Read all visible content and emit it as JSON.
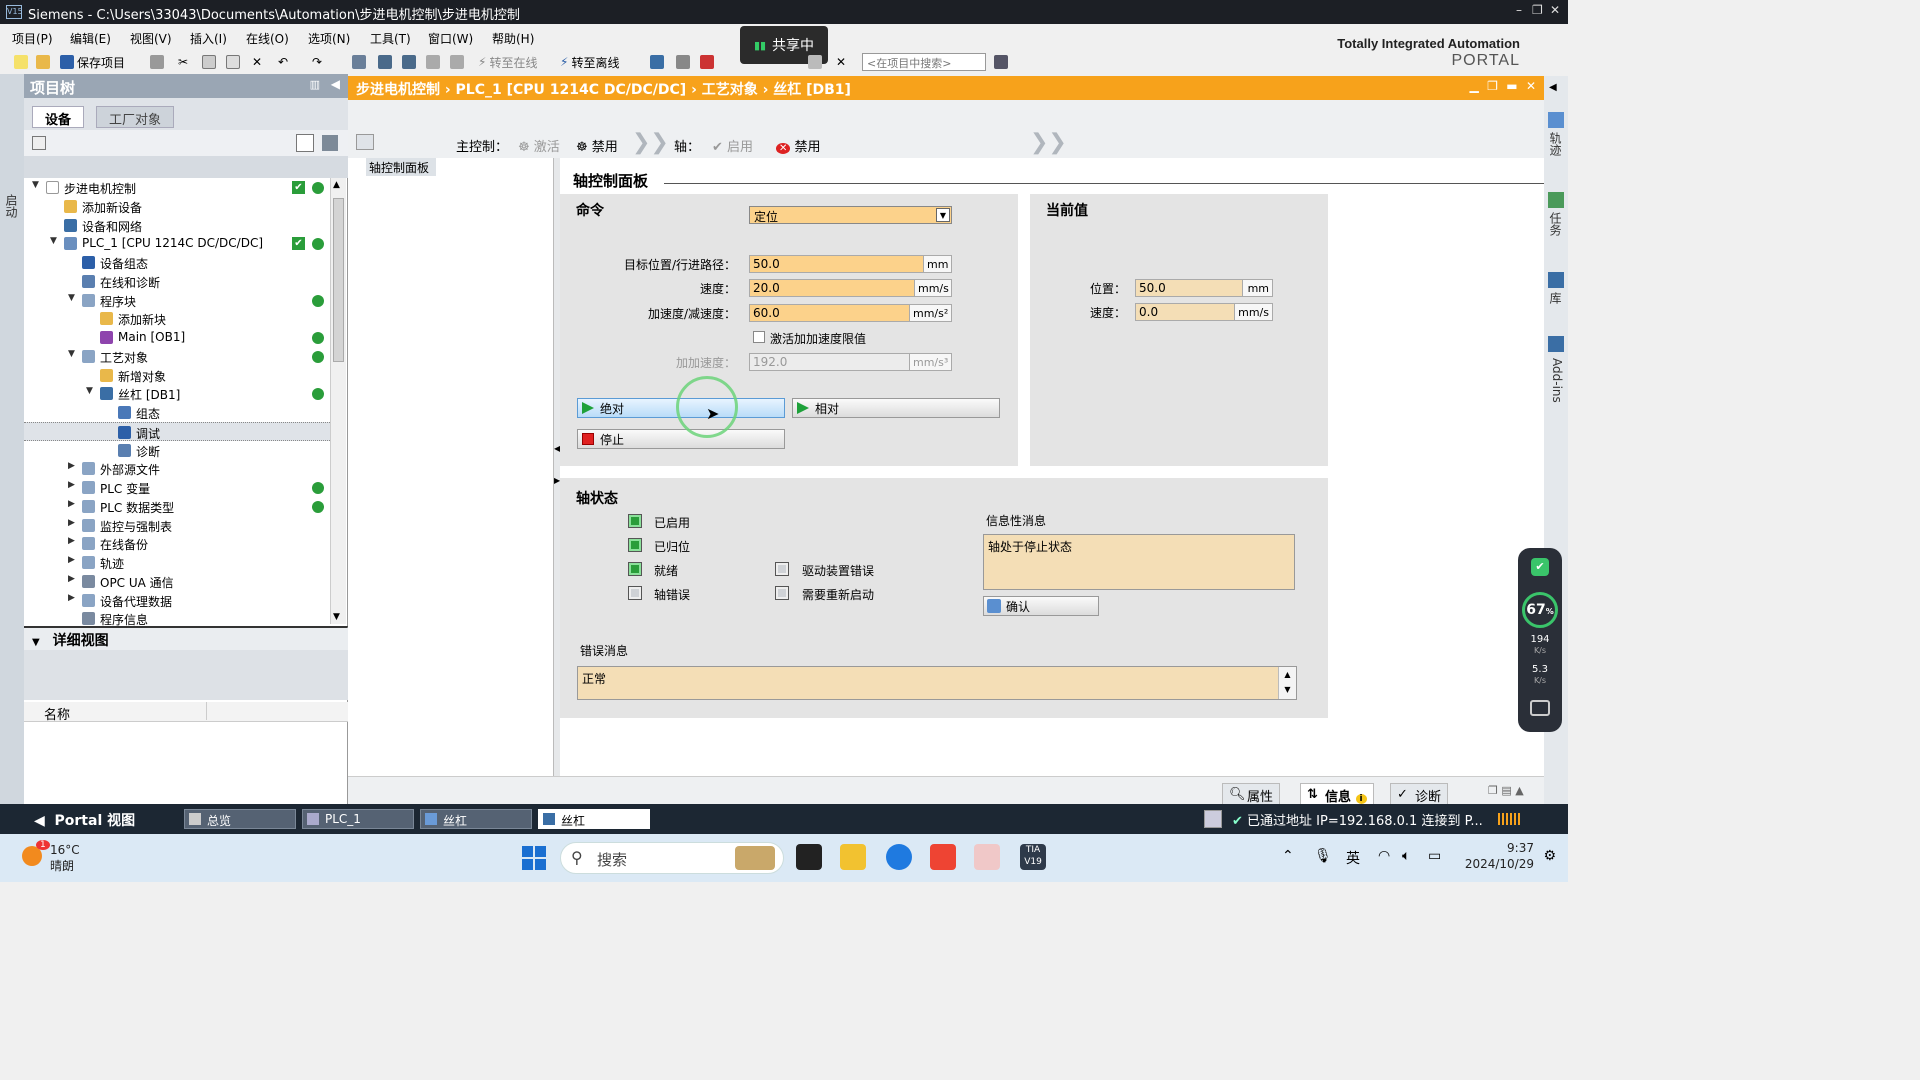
{
  "window": {
    "logo": "V15",
    "title": "Siemens   -   C:\\Users\\33043\\Documents\\Automation\\步进电机控制\\步进电机控制"
  },
  "menu": [
    "项目(P)",
    "编辑(E)",
    "视图(V)",
    "插入(I)",
    "在线(O)",
    "选项(N)",
    "工具(T)",
    "窗口(W)",
    "帮助(H)"
  ],
  "brand": {
    "line1": "Totally Integrated Automation",
    "line2": "PORTAL"
  },
  "share": {
    "label": "共享中"
  },
  "toolbar": {
    "save_project": "保存项目",
    "go_online": "转至在线",
    "go_offline": "转至离线",
    "search_placeholder": "<在项目中搜索>"
  },
  "left_strip": {
    "label": "启动"
  },
  "project_tree": {
    "title": "项目树",
    "tab_devices": "设备",
    "tab_plant": "工厂对象",
    "items": [
      {
        "label": "步进电机控制",
        "indent": 0,
        "arrow": "down",
        "icon": "project-icon",
        "check": true,
        "dot": true
      },
      {
        "label": "添加新设备",
        "indent": 1,
        "arrow": "",
        "icon": "add-device-icon"
      },
      {
        "label": "设备和网络",
        "indent": 1,
        "arrow": "",
        "icon": "network-icon"
      },
      {
        "label": "PLC_1 [CPU 1214C DC/DC/DC]",
        "indent": 1,
        "arrow": "down",
        "icon": "plc-icon",
        "check": true,
        "dot": true
      },
      {
        "label": "设备组态",
        "indent": 2,
        "arrow": "",
        "icon": "device-config-icon"
      },
      {
        "label": "在线和诊断",
        "indent": 2,
        "arrow": "",
        "icon": "online-diag-icon"
      },
      {
        "label": "程序块",
        "indent": 2,
        "arrow": "down",
        "icon": "folder-icon",
        "dot": true
      },
      {
        "label": "添加新块",
        "indent": 3,
        "arrow": "",
        "icon": "add-block-icon"
      },
      {
        "label": "Main [OB1]",
        "indent": 3,
        "arrow": "",
        "icon": "ob-icon",
        "dot": true
      },
      {
        "label": "工艺对象",
        "indent": 2,
        "arrow": "down",
        "icon": "folder-icon",
        "dot": true
      },
      {
        "label": "新增对象",
        "indent": 3,
        "arrow": "",
        "icon": "add-object-icon"
      },
      {
        "label": "丝杠 [DB1]",
        "indent": 3,
        "arrow": "down",
        "icon": "axis-icon",
        "dot": true
      },
      {
        "label": "组态",
        "indent": 4,
        "arrow": "",
        "icon": "config-icon"
      },
      {
        "label": "调试",
        "indent": 4,
        "arrow": "",
        "icon": "commissioning-icon",
        "selected": true
      },
      {
        "label": "诊断",
        "indent": 4,
        "arrow": "",
        "icon": "diag-icon"
      },
      {
        "label": "外部源文件",
        "indent": 2,
        "arrow": "right",
        "icon": "folder-icon"
      },
      {
        "label": "PLC 变量",
        "indent": 2,
        "arrow": "right",
        "icon": "folder-icon",
        "dot": true
      },
      {
        "label": "PLC 数据类型",
        "indent": 2,
        "arrow": "right",
        "icon": "folder-icon",
        "dot": true
      },
      {
        "label": "监控与强制表",
        "indent": 2,
        "arrow": "right",
        "icon": "folder-icon"
      },
      {
        "label": "在线备份",
        "indent": 2,
        "arrow": "right",
        "icon": "folder-icon"
      },
      {
        "label": "轨迹",
        "indent": 2,
        "arrow": "right",
        "icon": "folder-icon"
      },
      {
        "label": "OPC UA 通信",
        "indent": 2,
        "arrow": "right",
        "icon": "opc-icon"
      },
      {
        "label": "设备代理数据",
        "indent": 2,
        "arrow": "right",
        "icon": "folder-icon"
      },
      {
        "label": "程序信息",
        "indent": 2,
        "arrow": "",
        "icon": "info-icon"
      }
    ]
  },
  "detail_view": {
    "title": "详细视图",
    "col_name": "名称"
  },
  "editor": {
    "breadcrumb": "步进电机控制  ›  PLC_1 [CPU 1214C DC/DC/DC]  ›  工艺对象  ›  丝杠 [DB1]",
    "master_label": "主控制：",
    "activate": "激活",
    "deactivate": "禁用",
    "axis_label": "轴：",
    "enable": "启用",
    "disable": "禁用",
    "nav_item": "轴控制面板"
  },
  "panel": {
    "title": "轴控制面板",
    "command_label": "命令",
    "command_value": "定位",
    "target_label": "目标位置/行进路径：",
    "target_value": "50.0",
    "target_unit": "mm",
    "speed_label": "速度：",
    "speed_value": "20.0",
    "speed_unit": "mm/s",
    "accel_label": "加速度/减速度：",
    "accel_value": "60.0",
    "accel_unit": "mm/s²",
    "jerk_check_label": "激活加加速度限值",
    "jerk_label": "加加速度：",
    "jerk_value": "192.0",
    "jerk_unit": "mm/s³",
    "btn_absolute": "绝对",
    "btn_relative": "相对",
    "btn_stop": "停止",
    "current_label": "当前值",
    "pos_label": "位置：",
    "pos_value": "50.0",
    "pos_unit": "mm",
    "vel_label": "速度：",
    "vel_value": "0.0",
    "vel_unit": "mm/s",
    "status_label": "轴状态",
    "st_enabled": "已启用",
    "st_homed": "已归位",
    "st_ready": "就绪",
    "st_axis_error": "轴错误",
    "st_drive_error": "驱动装置错误",
    "st_restart": "需要重新启动",
    "info_label": "信息性消息",
    "info_text": "轴处于停止状态",
    "ack_button": "确认",
    "error_label": "错误消息",
    "error_text": "正常"
  },
  "right_strip": {
    "tab1": "轨迹",
    "tab2": "任务",
    "tab3": "库",
    "tab4": "Add-ins"
  },
  "inspector": {
    "properties": "属性",
    "info": "信息",
    "diagnostics": "诊断"
  },
  "portal_bar": {
    "portal_view": "Portal 视图",
    "tasks": [
      "总览",
      "PLC_1",
      "丝杠",
      "丝杠"
    ],
    "connection": "已通过地址 IP=192.168.0.1 连接到 P..."
  },
  "netwidget": {
    "percent": "67",
    "unit": "%",
    "up": "194",
    "down": "5.3",
    "rate_unit": "K/s"
  },
  "taskbar": {
    "temp": "16°C",
    "weather": "晴朗",
    "badge": "1",
    "search": "搜索",
    "ime": "英",
    "time": "9:37",
    "date": "2024/10/29"
  }
}
